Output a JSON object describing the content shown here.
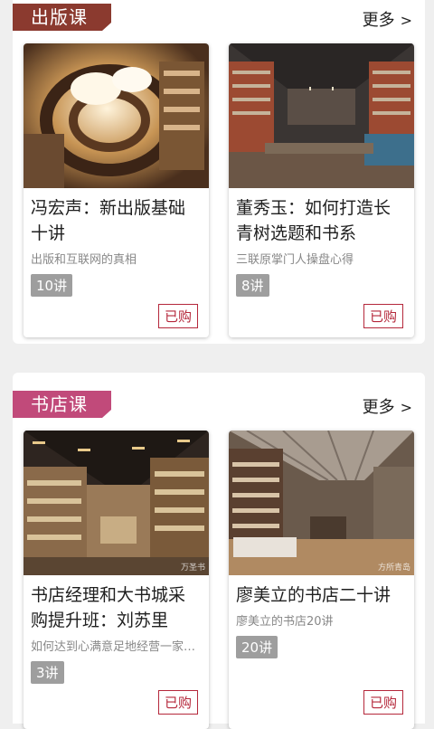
{
  "sections": [
    {
      "tag": "出版课",
      "more": "更多",
      "more_arrow": ">",
      "cards": [
        {
          "title": "冯宏声：新出版基础十讲",
          "subtitle": "出版和互联网的真相",
          "lessons": "10讲",
          "status": "已购"
        },
        {
          "title": "董秀玉：如何打造长青树选题和书系",
          "subtitle": "三联原掌门人操盘心得",
          "lessons": "8讲",
          "status": "已购"
        }
      ]
    },
    {
      "tag": "书店课",
      "more": "更多",
      "more_arrow": ">",
      "cards": [
        {
          "title": "书店经理和大书城采购提升班：刘苏里经…",
          "subtitle": "如何达到心满意足地经营一家…",
          "lessons": "3讲",
          "status": "已购",
          "watermark": "万圣书"
        },
        {
          "title": "廖美立的书店二十讲",
          "subtitle": "廖美立的书店20讲",
          "lessons": "20讲",
          "status": "已购",
          "watermark": "方所青岛"
        }
      ]
    }
  ],
  "colors": {
    "tag1": "#8b3a2f",
    "tag2": "#c14a7a",
    "buy": "#b5283b"
  }
}
